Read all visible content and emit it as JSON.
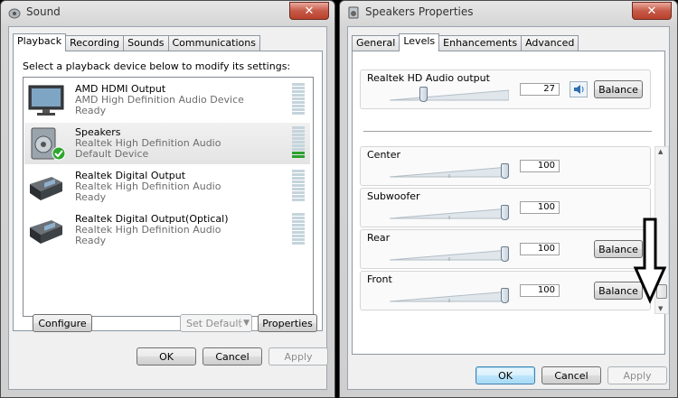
{
  "sound": {
    "title": "Sound",
    "tabs": [
      "Playback",
      "Recording",
      "Sounds",
      "Communications"
    ],
    "instruction": "Select a playback device below to modify its settings:",
    "devices": [
      {
        "name": "AMD HDMI Output",
        "desc": "AMD High Definition Audio Device",
        "status": "Ready",
        "icon": "monitor-icon",
        "selected": false
      },
      {
        "name": "Speakers",
        "desc": "Realtek High Definition Audio",
        "status": "Default Device",
        "icon": "speaker-icon",
        "selected": true
      },
      {
        "name": "Realtek Digital Output",
        "desc": "Realtek High Definition Audio",
        "status": "Ready",
        "icon": "digital-output-icon",
        "selected": false
      },
      {
        "name": "Realtek Digital Output(Optical)",
        "desc": "Realtek High Definition Audio",
        "status": "Ready",
        "icon": "digital-output-icon",
        "selected": false
      }
    ],
    "buttons": {
      "configure": "Configure",
      "set_default": "Set Default",
      "properties": "Properties",
      "ok": "OK",
      "cancel": "Cancel",
      "apply": "Apply"
    }
  },
  "speakers": {
    "title": "Speakers Properties",
    "tabs": [
      "General",
      "Levels",
      "Enhancements",
      "Advanced"
    ],
    "main": {
      "label": "Realtek HD Audio output",
      "value": "27",
      "level": 0.27,
      "balance": "Balance"
    },
    "channels": [
      {
        "label": "Center",
        "value": "100",
        "level": 1.0,
        "balance": ""
      },
      {
        "label": "Subwoofer",
        "value": "100",
        "level": 1.0,
        "balance": ""
      },
      {
        "label": "Rear",
        "value": "100",
        "level": 1.0,
        "balance": "Balance"
      },
      {
        "label": "Front",
        "value": "100",
        "level": 1.0,
        "balance": "Balance"
      }
    ],
    "buttons": {
      "ok": "OK",
      "cancel": "Cancel",
      "apply": "Apply"
    }
  },
  "colors": {
    "selection": "#e4e4e4",
    "close": "#c75a48",
    "meter_on": "#2ea12e",
    "meter_off": "#c5d4dc"
  }
}
